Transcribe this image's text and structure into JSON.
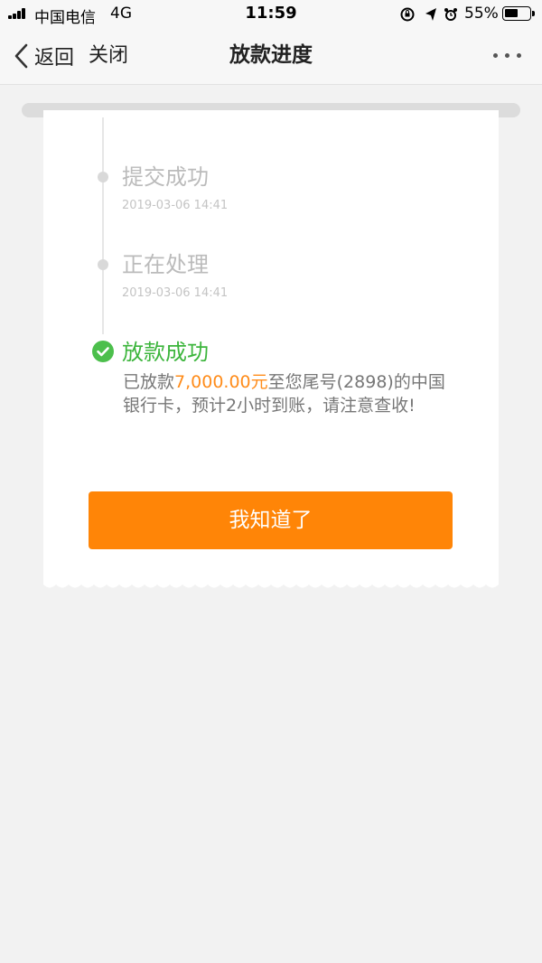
{
  "status_bar": {
    "carrier": "中国电信",
    "network": "4G",
    "time": "11:59",
    "battery_percent": "55%",
    "battery_level": 0.55
  },
  "nav": {
    "back_label": "返回",
    "close_label": "关闭",
    "title": "放款进度",
    "more_icon": "more-dots-icon"
  },
  "timeline": {
    "steps": [
      {
        "title": "提交成功",
        "time": "2019-03-06 14:41",
        "status": "done"
      },
      {
        "title": "正在处理",
        "time": "2019-03-06 14:41",
        "status": "done"
      },
      {
        "title": "放款成功",
        "status": "current"
      }
    ],
    "result": {
      "prefix": "已放款",
      "amount": "7,000.00元",
      "suffix": "至您尾号(2898)的中国银行卡，预计2小时到账，请注意查收!"
    }
  },
  "confirm_button": {
    "label": "我知道了"
  },
  "colors": {
    "accent": "#ff8507",
    "success": "#3cb53c",
    "amount": "#ff8c1a"
  }
}
